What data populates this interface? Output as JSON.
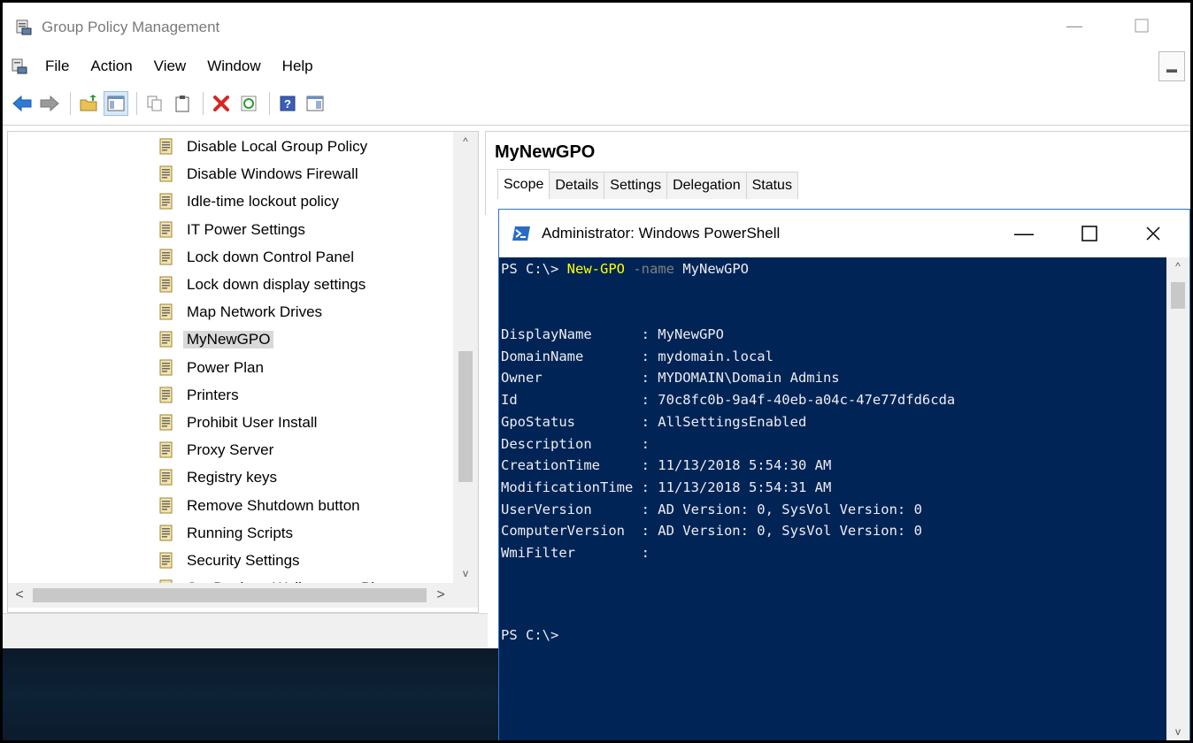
{
  "window": {
    "title": "Group Policy Management",
    "minimize_icon": "minimize-icon",
    "maximize_icon": "maximize-icon"
  },
  "menu": {
    "items": [
      "File",
      "Action",
      "View",
      "Window",
      "Help"
    ]
  },
  "toolbar": {
    "icons": [
      "back-arrow-icon",
      "forward-arrow-icon",
      "up-folder-icon",
      "show-hide-tree-icon",
      "copy-icon",
      "paste-icon",
      "delete-icon",
      "refresh-icon",
      "help-icon",
      "properties-icon"
    ]
  },
  "tree": {
    "items": [
      "Disable Local Group Policy",
      "Disable Windows Firewall",
      "Idle-time lockout policy",
      "IT Power Settings",
      "Lock down Control Panel",
      "Lock down display settings",
      "Map Network Drives",
      "MyNewGPO",
      "Power Plan",
      "Printers",
      "Prohibit User Install",
      "Proxy Server",
      "Registry keys",
      "Remove Shutdown button",
      "Running Scripts",
      "Security Settings",
      "Set Desktop Wallpaper to Pla..."
    ],
    "selected": "MyNewGPO"
  },
  "gpo": {
    "title": "MyNewGPO",
    "tabs": [
      "Scope",
      "Details",
      "Settings",
      "Delegation",
      "Status"
    ],
    "active_tab": "Scope"
  },
  "powershell": {
    "title": "Administrator: Windows PowerShell",
    "prompt": "PS C:\\> ",
    "command": "New-GPO",
    "param": "-name",
    "arg": "MyNewGPO",
    "output": [
      "DisplayName      : MyNewGPO",
      "DomainName       : mydomain.local",
      "Owner            : MYDOMAIN\\Domain Admins",
      "Id               : 70c8fc0b-9a4f-40eb-a04c-47e77dfd6cda",
      "GpoStatus        : AllSettingsEnabled",
      "Description      :",
      "CreationTime     : 11/13/2018 5:54:30 AM",
      "ModificationTime : 11/13/2018 5:54:31 AM",
      "UserVersion      : AD Version: 0, SysVol Version: 0",
      "ComputerVersion  : AD Version: 0, SysVol Version: 0",
      "WmiFilter        :"
    ],
    "final_prompt": "PS C:\\>",
    "background": "#012456"
  }
}
